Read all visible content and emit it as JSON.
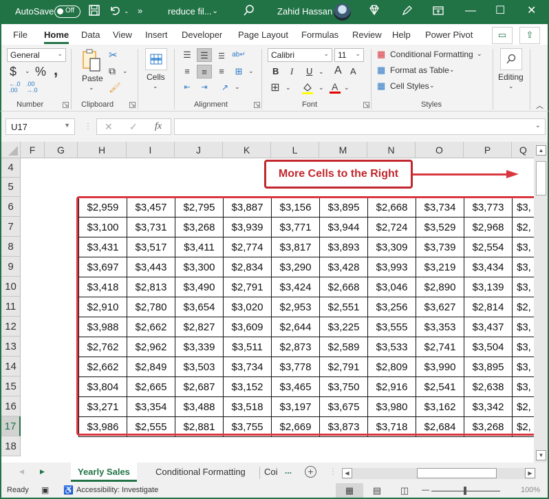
{
  "titlebar": {
    "autosave_label": "AutoSave",
    "autosave_state": "Off",
    "file_name": "reduce fil...",
    "user_name": "Zahid Hassan",
    "icons": [
      "save-icon",
      "undo-icon",
      "more-commands-icon",
      "search-icon",
      "diamond-icon",
      "pen-icon",
      "ribbon-display-icon",
      "minimize-icon",
      "maximize-icon",
      "close-icon"
    ],
    "overflow": "»",
    "minimize": "—",
    "maximize": "☐",
    "close": "✕"
  },
  "menu": {
    "tabs": [
      "File",
      "Home",
      "Data",
      "View",
      "Insert",
      "Developer",
      "Page Layout",
      "Formulas",
      "Review",
      "Help",
      "Power Pivot"
    ],
    "active": "Home"
  },
  "ribbon": {
    "number": {
      "format": "General",
      "currency": "$",
      "percent": "%",
      "comma": ",",
      "increase_decimal": "←.0 .00",
      "decrease_decimal": ".00 →.0",
      "label": "Number"
    },
    "clipboard": {
      "paste": "Paste",
      "label": "Clipboard"
    },
    "cells": {
      "label": "Cells"
    },
    "alignment": {
      "label": "Alignment"
    },
    "font": {
      "name": "Calibri",
      "size": "11",
      "bold": "B",
      "italic": "I",
      "underline": "U",
      "grow": "A",
      "shrink": "A",
      "fill_color": "#ffff00",
      "font_color": "#e00000",
      "label": "Font"
    },
    "styles": {
      "conditional_formatting": "Conditional Formatting",
      "format_as_table": "Format as Table",
      "cell_styles": "Cell Styles",
      "label": "Styles"
    },
    "editing": {
      "label": "Editing"
    }
  },
  "formula_bar": {
    "name_box": "U17",
    "cancel": "✕",
    "enter": "✓",
    "fx": "fx",
    "formula": ""
  },
  "sheet": {
    "columns": [
      "F",
      "G",
      "H",
      "I",
      "J",
      "K",
      "L",
      "M",
      "N",
      "O",
      "P",
      "Q"
    ],
    "rows": [
      "4",
      "5",
      "6",
      "7",
      "8",
      "9",
      "10",
      "11",
      "12",
      "13",
      "14",
      "15",
      "16",
      "17",
      "18"
    ],
    "selected_row": "17",
    "callout": "More Cells to the Right",
    "accent_color": "#d9363e",
    "data": [
      [
        "$2,959",
        "$3,457",
        "$2,795",
        "$3,887",
        "$3,156",
        "$3,895",
        "$2,668",
        "$3,734",
        "$3,773",
        "$3,"
      ],
      [
        "$3,100",
        "$3,731",
        "$3,268",
        "$3,939",
        "$3,771",
        "$3,944",
        "$2,724",
        "$3,529",
        "$2,968",
        "$2,"
      ],
      [
        "$3,431",
        "$3,517",
        "$3,411",
        "$2,774",
        "$3,817",
        "$3,893",
        "$3,309",
        "$3,739",
        "$2,554",
        "$3,"
      ],
      [
        "$3,697",
        "$3,443",
        "$3,300",
        "$2,834",
        "$3,290",
        "$3,428",
        "$3,993",
        "$3,219",
        "$3,434",
        "$3,"
      ],
      [
        "$3,418",
        "$2,813",
        "$3,490",
        "$2,791",
        "$3,424",
        "$2,668",
        "$3,046",
        "$2,890",
        "$3,139",
        "$3,"
      ],
      [
        "$2,910",
        "$2,780",
        "$3,654",
        "$3,020",
        "$2,953",
        "$2,551",
        "$3,256",
        "$3,627",
        "$2,814",
        "$2,"
      ],
      [
        "$3,988",
        "$2,662",
        "$2,827",
        "$3,609",
        "$2,644",
        "$3,225",
        "$3,555",
        "$3,353",
        "$3,437",
        "$3,"
      ],
      [
        "$2,762",
        "$2,962",
        "$3,339",
        "$3,511",
        "$2,873",
        "$2,589",
        "$3,533",
        "$2,741",
        "$3,504",
        "$3,"
      ],
      [
        "$2,662",
        "$2,849",
        "$3,503",
        "$3,734",
        "$3,778",
        "$2,791",
        "$2,809",
        "$3,990",
        "$3,895",
        "$3,"
      ],
      [
        "$3,804",
        "$2,665",
        "$2,687",
        "$3,152",
        "$3,465",
        "$3,750",
        "$2,916",
        "$2,541",
        "$2,638",
        "$3,"
      ],
      [
        "$3,271",
        "$3,354",
        "$3,488",
        "$3,518",
        "$3,197",
        "$3,675",
        "$3,980",
        "$3,162",
        "$3,342",
        "$2,"
      ],
      [
        "$3,986",
        "$2,555",
        "$2,881",
        "$3,755",
        "$2,669",
        "$3,873",
        "$3,718",
        "$2,684",
        "$3,268",
        "$2,"
      ]
    ]
  },
  "sheet_tabs": {
    "tabs": [
      "Yearly Sales",
      "Conditional Formatting",
      "Coi"
    ],
    "active": "Yearly Sales",
    "more": "...",
    "add": "+"
  },
  "status": {
    "ready": "Ready",
    "accessibility": "Accessibility: Investigate",
    "zoom": "100%",
    "zoom_minus": "—"
  }
}
